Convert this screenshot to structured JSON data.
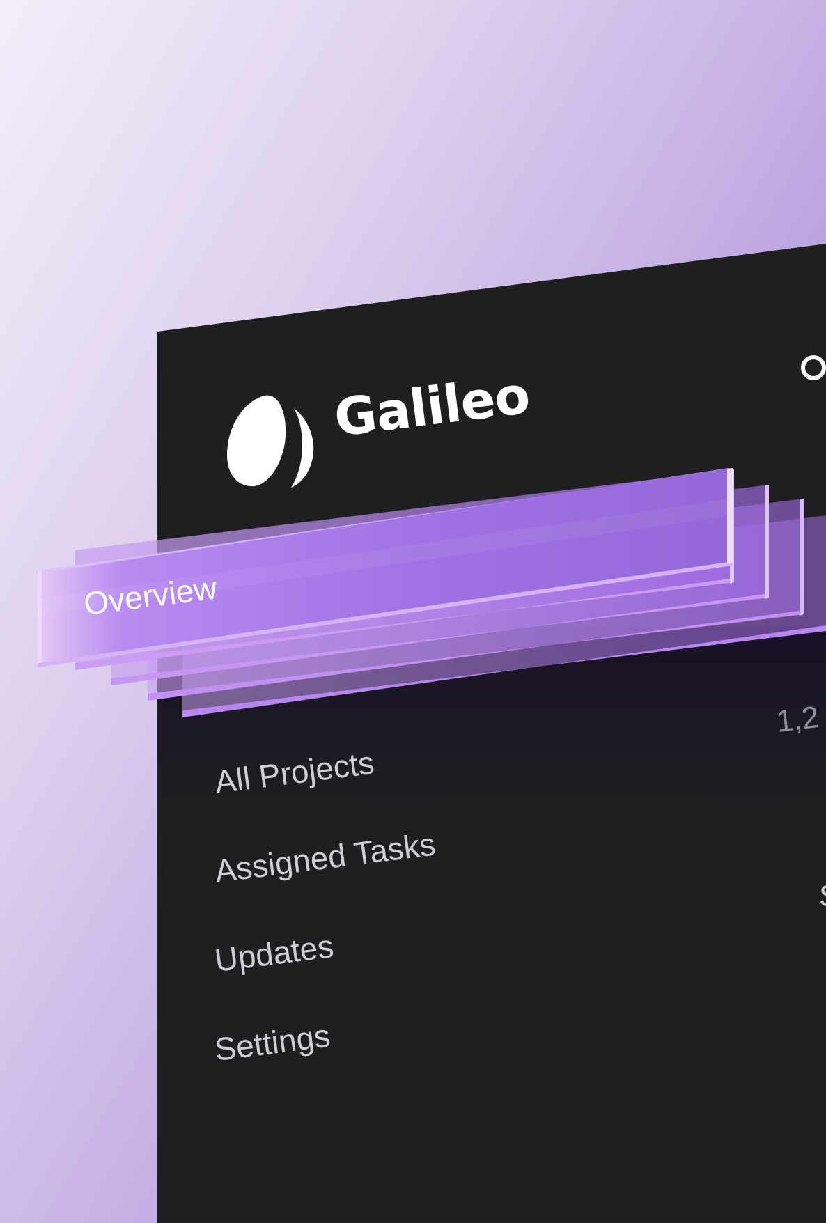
{
  "app": {
    "brand_name": "Galileo",
    "logo_icon": "half-moon-logo-icon",
    "search_icon": "search-icon"
  },
  "sidebar": {
    "active_item": {
      "label": "Overview"
    },
    "items": [
      {
        "label": "All Projects"
      },
      {
        "label": "Assigned Tasks"
      },
      {
        "label": "Updates"
      },
      {
        "label": "Settings"
      }
    ]
  },
  "main": {
    "count_partial": "1,2",
    "edge_glyph_partial": "S"
  },
  "colors": {
    "accent": "#a875e6",
    "panel": "#1f1f21",
    "text_primary": "#ffffff",
    "text_secondary": "#cfcfd3"
  }
}
